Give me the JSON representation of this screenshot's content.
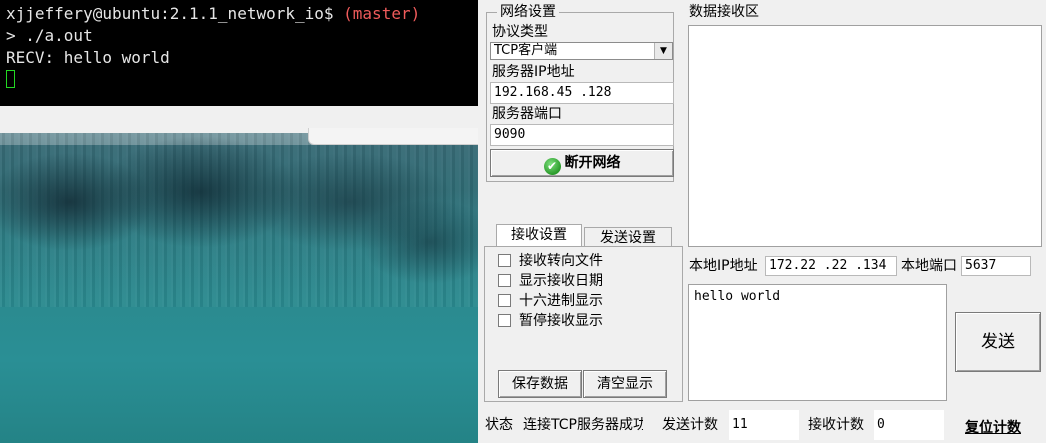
{
  "terminal": {
    "prompt_user": "xjjeffery@ubuntu:2.1.1_network_io$",
    "prompt_branch": "(master)",
    "command": "> ./a.out",
    "output": "RECV: hello world"
  },
  "network": {
    "group_title": "网络设置",
    "protocol_label": "协议类型",
    "protocol_value": "TCP客户端",
    "server_ip_label": "服务器IP地址",
    "server_ip_value": "192.168.45 .128",
    "server_port_label": "服务器端口",
    "server_port_value": "9090",
    "disconnect_label": "断开网络"
  },
  "receive": {
    "area_label": "数据接收区"
  },
  "tabs": [
    {
      "label": "接收设置"
    },
    {
      "label": "发送设置"
    }
  ],
  "recv_options": [
    {
      "label": "接收转向文件",
      "checked": false
    },
    {
      "label": "显示接收日期",
      "checked": false
    },
    {
      "label": "十六进制显示",
      "checked": false
    },
    {
      "label": "暂停接收显示",
      "checked": false
    }
  ],
  "recv_buttons": {
    "save_label": "保存数据",
    "clear_label": "清空显示"
  },
  "local": {
    "ip_label": "本地IP地址",
    "ip_value": "172.22 .22 .134",
    "port_label": "本地端口",
    "port_value": "5637"
  },
  "send": {
    "text": "hello world",
    "button_label": "发送"
  },
  "status": {
    "state_label": "状态",
    "state_value": "连接TCP服务器成功",
    "send_count_label": "发送计数",
    "send_count_value": "11",
    "recv_count_label": "接收计数",
    "recv_count_value": "0",
    "reset_label": "复位计数"
  }
}
